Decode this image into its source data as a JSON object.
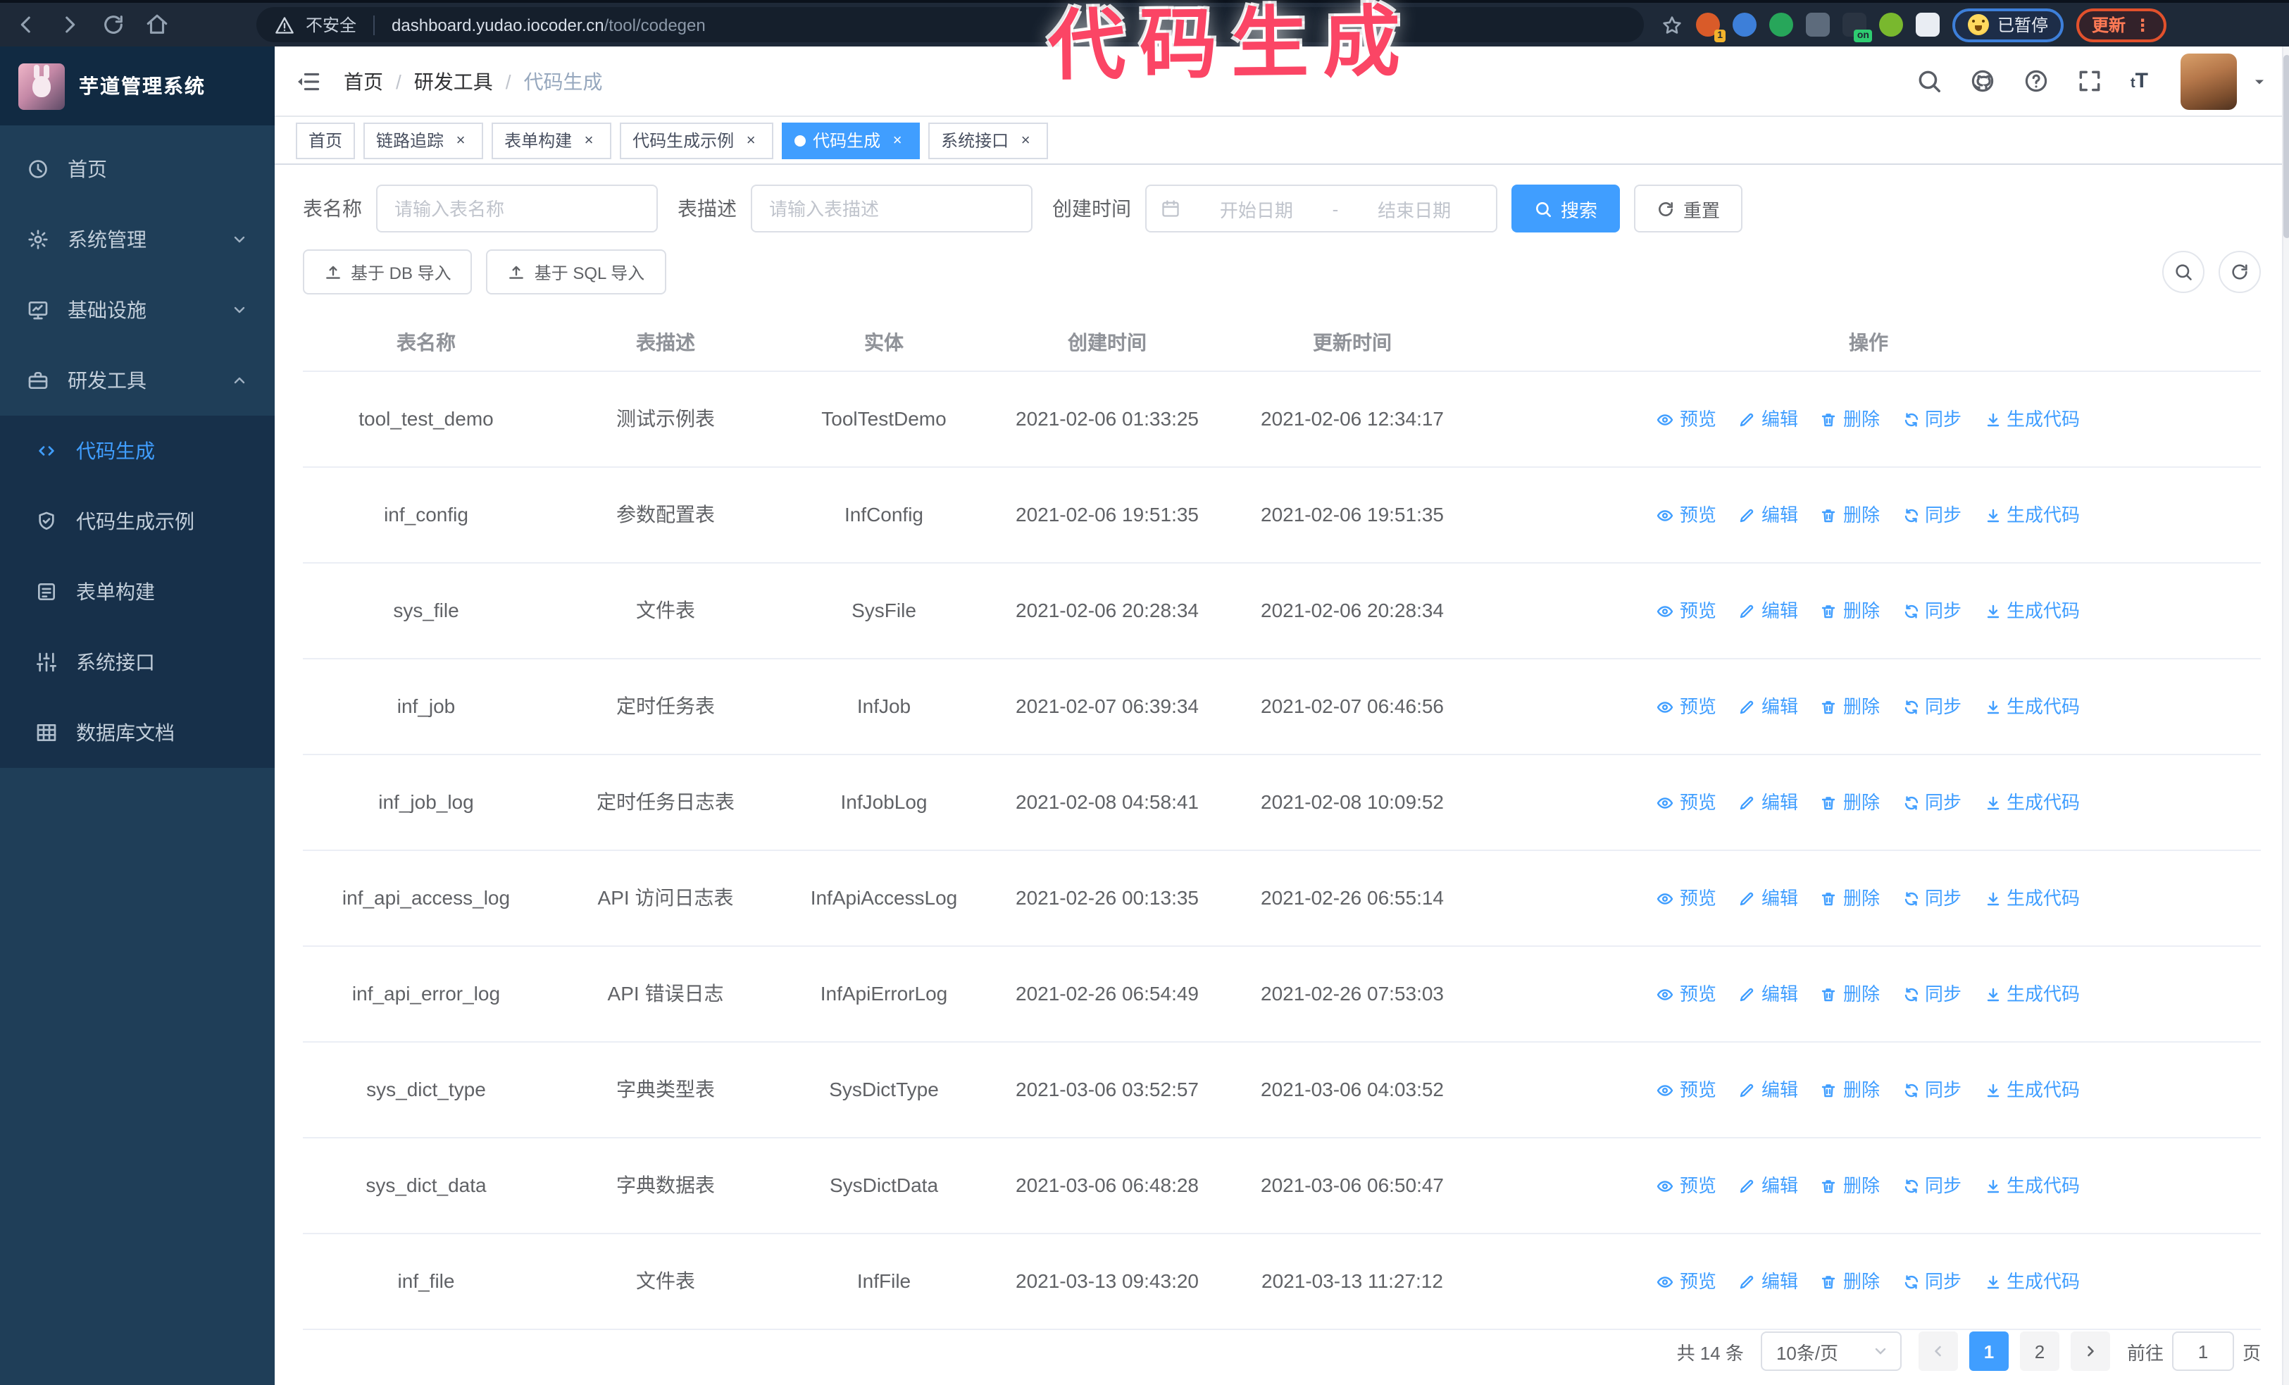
{
  "annotation": {
    "text": "代码生成",
    "color": "#fb4565"
  },
  "browser": {
    "security_label": "不安全",
    "url_domain": "dashboard.yudao.iocoder.cn",
    "url_path": "/tool/codegen",
    "paused_badge": "已暂停",
    "update_badge": "更新",
    "nav_icons": [
      "back-icon",
      "forward-icon",
      "reload-icon",
      "home-icon"
    ],
    "extensions": [
      {
        "name": "extension-orange-icon",
        "shape": "circle",
        "color": "#d95b29",
        "badge": "1",
        "badge_color": "#f2b32c"
      },
      {
        "name": "extension-blue-gem-icon",
        "shape": "circle",
        "color": "#3d7fd9",
        "badge": "",
        "badge_color": ""
      },
      {
        "name": "extension-green-check-icon",
        "shape": "circle",
        "color": "#27a65a",
        "badge": "",
        "badge_color": ""
      },
      {
        "name": "extension-grid-icon",
        "shape": "square",
        "color": "#5d6b7c",
        "badge": "",
        "badge_color": ""
      },
      {
        "name": "extension-dark-on-icon",
        "shape": "square",
        "color": "#2a3442",
        "badge": "on",
        "badge_color": "#2ecc71"
      },
      {
        "name": "extension-green-bot-icon",
        "shape": "circle",
        "color": "#79b82e",
        "badge": "",
        "badge_color": ""
      },
      {
        "name": "extension-puzzle-icon",
        "shape": "square",
        "color": "#e9edf3",
        "badge": "",
        "badge_color": ""
      }
    ]
  },
  "sidebar": {
    "logo_title": "芋道管理系统",
    "items": [
      {
        "key": "home",
        "label": "首页",
        "icon": "dashboard-icon",
        "chevron": "",
        "active": false
      },
      {
        "key": "system",
        "label": "系统管理",
        "icon": "gear-icon",
        "chevron": "down",
        "active": false
      },
      {
        "key": "infra",
        "label": "基础设施",
        "icon": "monitor-icon",
        "chevron": "down",
        "active": false
      },
      {
        "key": "devtools",
        "label": "研发工具",
        "icon": "toolbox-icon",
        "chevron": "up",
        "active": false,
        "children": [
          {
            "key": "codegen",
            "label": "代码生成",
            "icon": "code-icon",
            "active": true
          },
          {
            "key": "codegen-example",
            "label": "代码生成示例",
            "icon": "shield-check-icon",
            "active": false
          },
          {
            "key": "form-builder",
            "label": "表单构建",
            "icon": "form-icon",
            "active": false
          },
          {
            "key": "system-api",
            "label": "系统接口",
            "icon": "sliders-icon",
            "active": false
          },
          {
            "key": "db-doc",
            "label": "数据库文档",
            "icon": "table-grid-icon",
            "active": false
          }
        ]
      }
    ]
  },
  "header": {
    "breadcrumb": [
      "首页",
      "研发工具",
      "代码生成"
    ],
    "separator": "/",
    "right_icons": [
      "search-icon",
      "github-icon",
      "question-icon",
      "fullscreen-icon",
      "font-size-icon"
    ],
    "font_size_glyph": "tT"
  },
  "tabs": [
    {
      "label": "首页",
      "closable": false,
      "active": false
    },
    {
      "label": "链路追踪",
      "closable": true,
      "active": false
    },
    {
      "label": "表单构建",
      "closable": true,
      "active": false
    },
    {
      "label": "代码生成示例",
      "closable": true,
      "active": false
    },
    {
      "label": "代码生成",
      "closable": true,
      "active": true
    },
    {
      "label": "系统接口",
      "closable": true,
      "active": false
    }
  ],
  "filters": {
    "name_label": "表名称",
    "name_placeholder": "请输入表名称",
    "name_value": "",
    "desc_label": "表描述",
    "desc_placeholder": "请输入表描述",
    "desc_value": "",
    "time_label": "创建时间",
    "time_start_placeholder": "开始日期",
    "time_end_placeholder": "结束日期",
    "range_separator": "-",
    "search_label": "搜索",
    "reset_label": "重置"
  },
  "toolbar": {
    "import_db_label": "基于 DB 导入",
    "import_sql_label": "基于 SQL 导入",
    "right_buttons": [
      "search-toggle-icon",
      "refresh-icon"
    ]
  },
  "table": {
    "columns": [
      "表名称",
      "表描述",
      "实体",
      "创建时间",
      "更新时间",
      "操作"
    ],
    "rows": [
      {
        "name": "tool_test_demo",
        "desc": "测试示例表",
        "entity": "ToolTestDemo",
        "created": "2021-02-06 01:33:25",
        "updated": "2021-02-06 12:34:17"
      },
      {
        "name": "inf_config",
        "desc": "参数配置表",
        "entity": "InfConfig",
        "created": "2021-02-06 19:51:35",
        "updated": "2021-02-06 19:51:35"
      },
      {
        "name": "sys_file",
        "desc": "文件表",
        "entity": "SysFile",
        "created": "2021-02-06 20:28:34",
        "updated": "2021-02-06 20:28:34"
      },
      {
        "name": "inf_job",
        "desc": "定时任务表",
        "entity": "InfJob",
        "created": "2021-02-07 06:39:34",
        "updated": "2021-02-07 06:46:56"
      },
      {
        "name": "inf_job_log",
        "desc": "定时任务日志表",
        "entity": "InfJobLog",
        "created": "2021-02-08 04:58:41",
        "updated": "2021-02-08 10:09:52"
      },
      {
        "name": "inf_api_access_log",
        "desc": "API 访问日志表",
        "entity": "InfApiAccessLog",
        "created": "2021-02-26 00:13:35",
        "updated": "2021-02-26 06:55:14"
      },
      {
        "name": "inf_api_error_log",
        "desc": "API 错误日志",
        "entity": "InfApiErrorLog",
        "created": "2021-02-26 06:54:49",
        "updated": "2021-02-26 07:53:03"
      },
      {
        "name": "sys_dict_type",
        "desc": "字典类型表",
        "entity": "SysDictType",
        "created": "2021-03-06 03:52:57",
        "updated": "2021-03-06 04:03:52"
      },
      {
        "name": "sys_dict_data",
        "desc": "字典数据表",
        "entity": "SysDictData",
        "created": "2021-03-06 06:48:28",
        "updated": "2021-03-06 06:50:47"
      },
      {
        "name": "inf_file",
        "desc": "文件表",
        "entity": "InfFile",
        "created": "2021-03-13 09:43:20",
        "updated": "2021-03-13 11:27:12"
      }
    ],
    "actions": [
      {
        "label": "预览",
        "icon": "eye-icon"
      },
      {
        "label": "编辑",
        "icon": "edit-icon"
      },
      {
        "label": "删除",
        "icon": "trash-icon"
      },
      {
        "label": "同步",
        "icon": "sync-icon"
      },
      {
        "label": "生成代码",
        "icon": "download-icon"
      }
    ]
  },
  "pagination": {
    "total_label": "共 14 条",
    "page_size_label": "10条/页",
    "pages": [
      "1",
      "2"
    ],
    "active_page": "1",
    "goto_prefix": "前往",
    "goto_value": "1",
    "goto_suffix": "页"
  },
  "colors": {
    "accent": "#409eff",
    "sidebar_bg": "#1f3e58",
    "submenu_bg": "#17304a",
    "logo_bg": "#112a42",
    "browser_bar_bg": "#1e2938",
    "annotation_pink": "#fb4565",
    "update_orange": "#ff7a55",
    "paused_border_blue": "#3d7fd9"
  }
}
